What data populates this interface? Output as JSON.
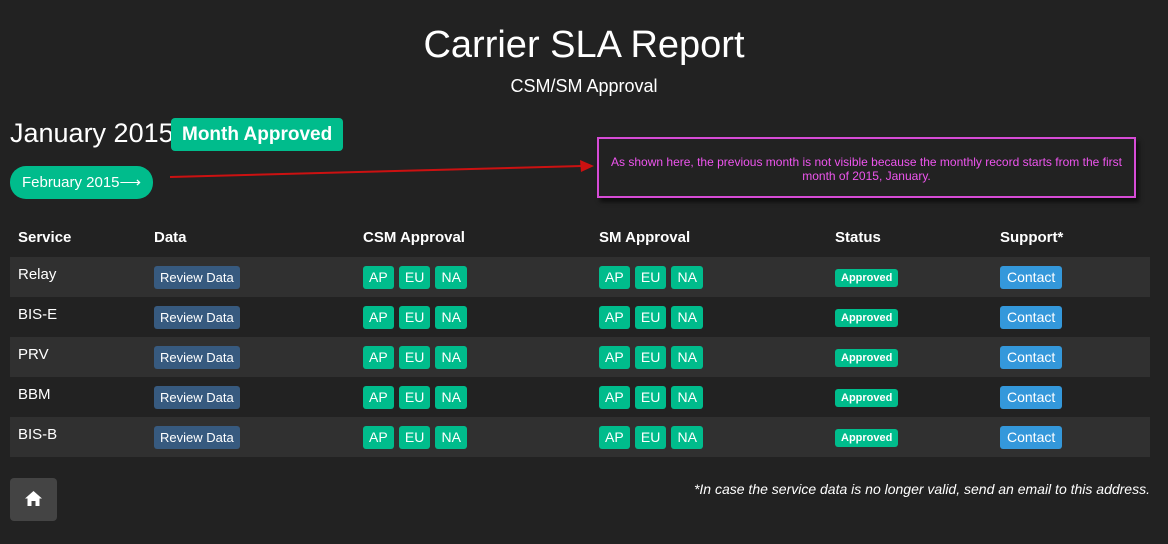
{
  "header": {
    "title": "Carrier SLA Report",
    "subtitle": "CSM/SM Approval"
  },
  "period": {
    "month": "January 2015",
    "status": "Month Approved",
    "next_month_label": "February 2015⟶"
  },
  "annotation": {
    "text": "As shown here, the previous month is not visible because the monthly record starts from the first month of 2015, January."
  },
  "table": {
    "headers": [
      "Service",
      "Data",
      "CSM Approval",
      "SM Approval",
      "Status",
      "Support*"
    ],
    "rows": [
      {
        "service": "Relay",
        "data": "Review Data",
        "csm": [
          "AP",
          "EU",
          "NA"
        ],
        "sm": [
          "AP",
          "EU",
          "NA"
        ],
        "status": "Approved",
        "support": "Contact"
      },
      {
        "service": "BIS-E",
        "data": "Review Data",
        "csm": [
          "AP",
          "EU",
          "NA"
        ],
        "sm": [
          "AP",
          "EU",
          "NA"
        ],
        "status": "Approved",
        "support": "Contact"
      },
      {
        "service": "PRV",
        "data": "Review Data",
        "csm": [
          "AP",
          "EU",
          "NA"
        ],
        "sm": [
          "AP",
          "EU",
          "NA"
        ],
        "status": "Approved",
        "support": "Contact"
      },
      {
        "service": "BBM",
        "data": "Review Data",
        "csm": [
          "AP",
          "EU",
          "NA"
        ],
        "sm": [
          "AP",
          "EU",
          "NA"
        ],
        "status": "Approved",
        "support": "Contact"
      },
      {
        "service": "BIS-B",
        "data": "Review Data",
        "csm": [
          "AP",
          "EU",
          "NA"
        ],
        "sm": [
          "AP",
          "EU",
          "NA"
        ],
        "status": "Approved",
        "support": "Contact"
      }
    ]
  },
  "footer": {
    "home_icon": "home-icon",
    "note": "*In case the service data is no longer valid, send an email to this address."
  },
  "colors": {
    "background": "#222222",
    "success": "#00bc8c",
    "primary": "#375a7f",
    "info": "#3498db",
    "annotation": "#d64bd6",
    "arrow": "#cc1111"
  }
}
